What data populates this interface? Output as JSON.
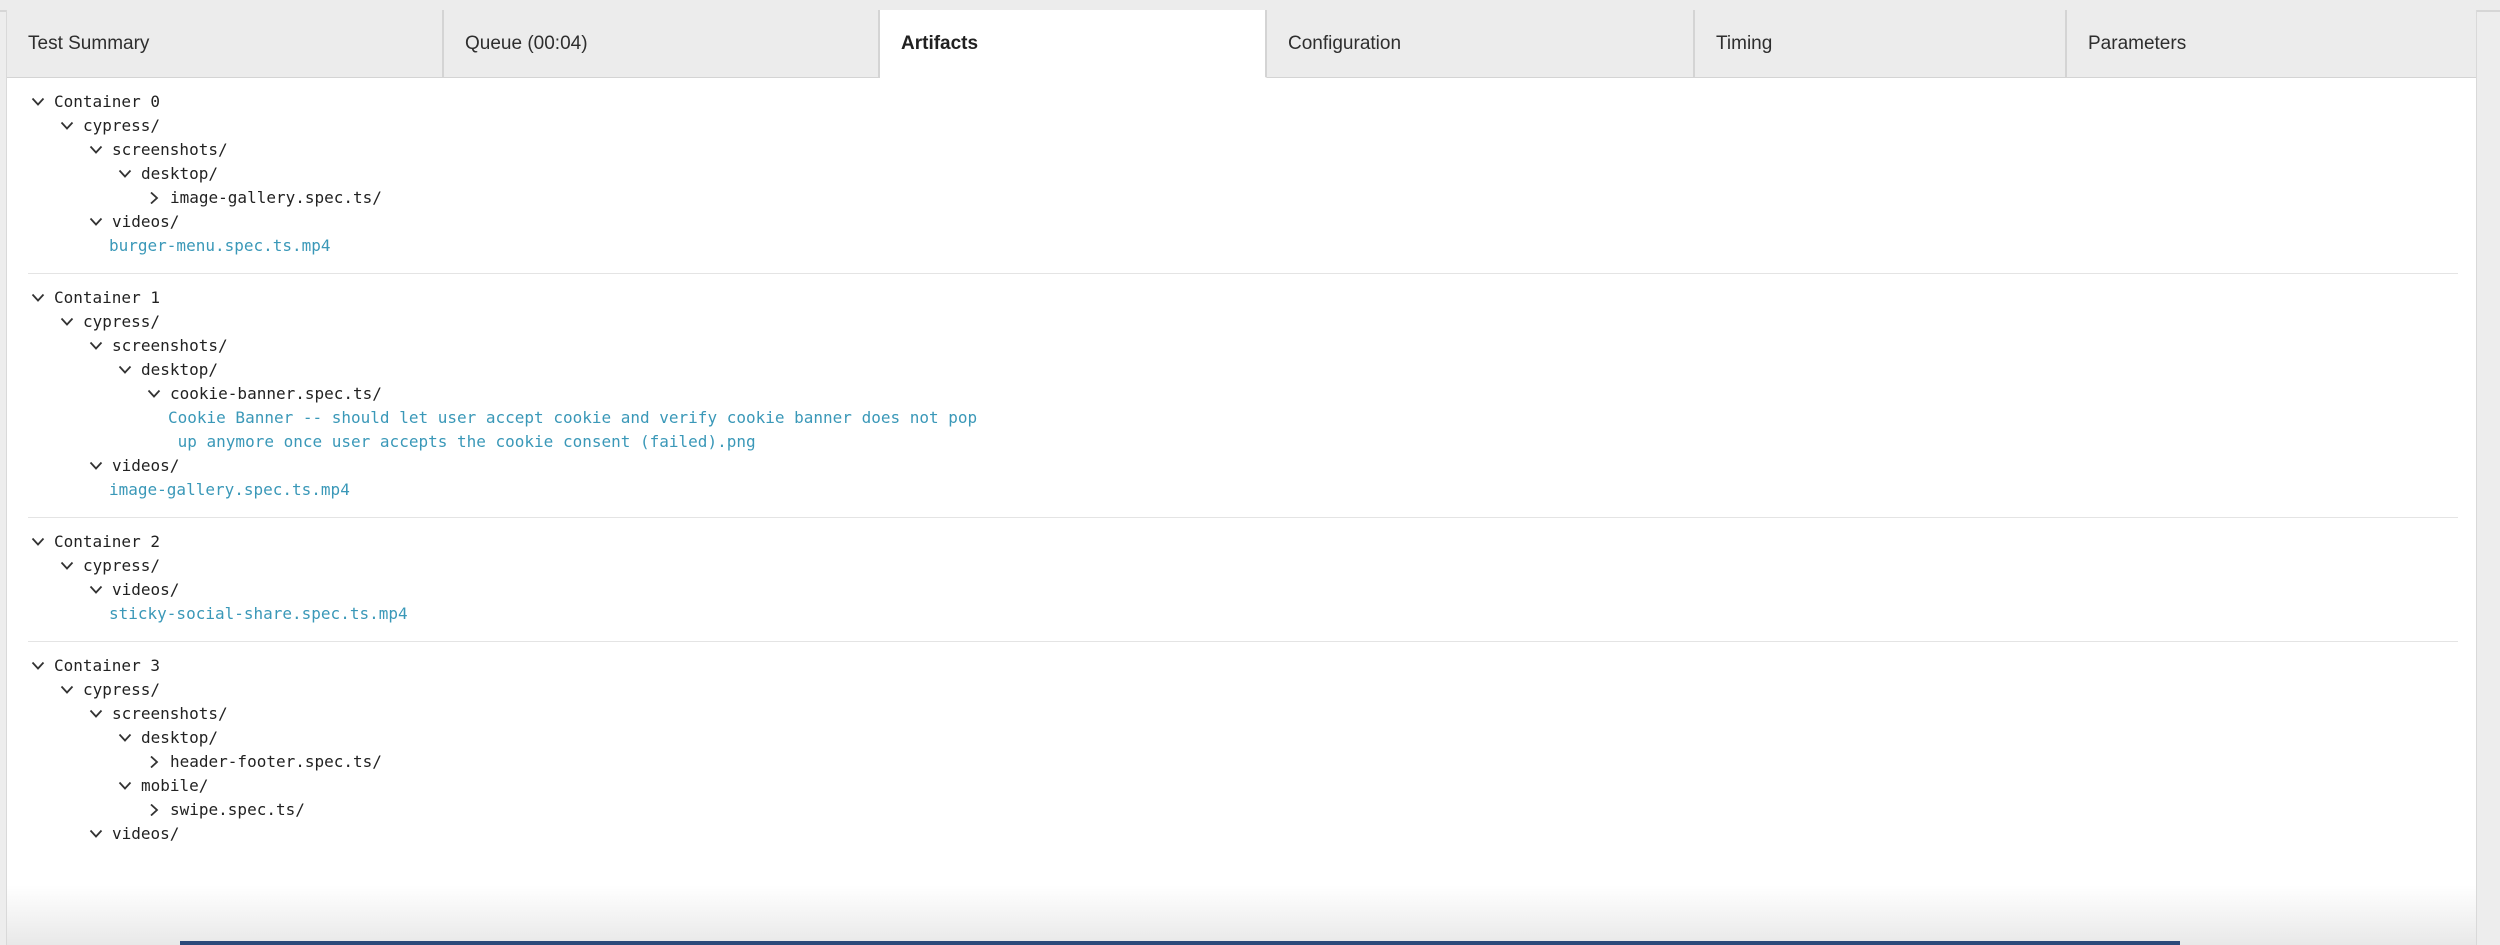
{
  "tabs": [
    {
      "label": "Test Summary",
      "active": false
    },
    {
      "label": "Queue (00:04)",
      "active": false
    },
    {
      "label": "Artifacts",
      "active": true
    },
    {
      "label": "Configuration",
      "active": false
    },
    {
      "label": "Timing",
      "active": false
    },
    {
      "label": "Parameters",
      "active": false
    }
  ],
  "containers": [
    {
      "name": "Container 0",
      "rows": [
        {
          "depth": 1,
          "label": "cypress/",
          "icon": "chevron-down"
        },
        {
          "depth": 2,
          "label": "screenshots/",
          "icon": "chevron-down"
        },
        {
          "depth": 3,
          "label": "desktop/",
          "icon": "chevron-down"
        },
        {
          "depth": 4,
          "label": "image-gallery.spec.ts/",
          "icon": "chevron-right"
        },
        {
          "depth": 2,
          "label": "videos/",
          "icon": "chevron-down"
        },
        {
          "file": true,
          "label": "burger-menu.spec.ts.mp4"
        }
      ]
    },
    {
      "name": "Container 1",
      "rows": [
        {
          "depth": 1,
          "label": "cypress/",
          "icon": "chevron-down"
        },
        {
          "depth": 2,
          "label": "screenshots/",
          "icon": "chevron-down"
        },
        {
          "depth": 3,
          "label": "desktop/",
          "icon": "chevron-down"
        },
        {
          "depth": 4,
          "label": "cookie-banner.spec.ts/",
          "icon": "chevron-down"
        },
        {
          "file": true,
          "deep": true,
          "label": "Cookie Banner -- should let user accept cookie and verify cookie banner does not pop\n up anymore once user accepts the cookie consent (failed).png"
        },
        {
          "depth": 2,
          "label": "videos/",
          "icon": "chevron-down"
        },
        {
          "file": true,
          "label": "image-gallery.spec.ts.mp4"
        }
      ]
    },
    {
      "name": "Container 2",
      "rows": [
        {
          "depth": 1,
          "label": "cypress/",
          "icon": "chevron-down"
        },
        {
          "depth": 2,
          "label": "videos/",
          "icon": "chevron-down"
        },
        {
          "file": true,
          "label": "sticky-social-share.spec.ts.mp4"
        }
      ]
    },
    {
      "name": "Container 3",
      "rows": [
        {
          "depth": 1,
          "label": "cypress/",
          "icon": "chevron-down"
        },
        {
          "depth": 2,
          "label": "screenshots/",
          "icon": "chevron-down"
        },
        {
          "depth": 3,
          "label": "desktop/",
          "icon": "chevron-down"
        },
        {
          "depth": 4,
          "label": "header-footer.spec.ts/",
          "icon": "chevron-right"
        },
        {
          "depth": 3,
          "label": "mobile/",
          "icon": "chevron-down"
        },
        {
          "depth": 4,
          "label": "swipe.spec.ts/",
          "icon": "chevron-right"
        },
        {
          "depth": 2,
          "label": "videos/",
          "icon": "chevron-down"
        }
      ]
    }
  ]
}
